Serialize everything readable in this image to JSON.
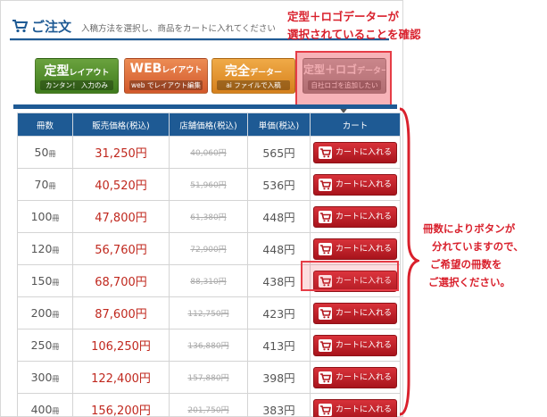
{
  "header": {
    "title": "ご注文",
    "description": "入稿方法を選択し、商品をカートに入れてください"
  },
  "layout_buttons": [
    {
      "main": "定型",
      "main_small": "レイアウト",
      "sub": "カンタン！ 入力のみ"
    },
    {
      "main": "WEB",
      "main_small": "レイアウト",
      "sub": "web でレイアウト編集"
    },
    {
      "main": "完全",
      "main_small": "データー",
      "sub": "ai ファイルで入稿"
    },
    {
      "main": "定型＋ロゴ",
      "main_small": "データー",
      "sub": "自社ロゴを追加したい"
    }
  ],
  "annotations": {
    "top_line1": "定型＋ロゴデーターが",
    "top_line2": "選択されていることを確認",
    "side_line1": "冊数によりボタンが",
    "side_line2": "分れていますので、",
    "side_line3": "ご希望の冊数を",
    "side_line4": "ご選択ください。"
  },
  "colors": {
    "primary_blue": "#1e5a94",
    "price_red": "#c0281e",
    "cart_red": "#b3181f",
    "annotation_red": "#d9202c"
  },
  "table": {
    "headers": [
      "冊数",
      "販売価格(税込)",
      "店舗価格(税込)",
      "単価(税込)",
      "カート"
    ],
    "qty_unit": "冊",
    "cart_label": "カートに入れる",
    "rows": [
      {
        "qty": "50",
        "sale": "31,250円",
        "store": "40,060円",
        "unit": "565円"
      },
      {
        "qty": "70",
        "sale": "40,520円",
        "store": "51,960円",
        "unit": "536円"
      },
      {
        "qty": "100",
        "sale": "47,800円",
        "store": "61,380円",
        "unit": "448円"
      },
      {
        "qty": "120",
        "sale": "56,760円",
        "store": "72,900円",
        "unit": "448円"
      },
      {
        "qty": "150",
        "sale": "68,700円",
        "store": "88,310円",
        "unit": "438円"
      },
      {
        "qty": "200",
        "sale": "87,600円",
        "store": "112,750円",
        "unit": "423円"
      },
      {
        "qty": "250",
        "sale": "106,250円",
        "store": "136,880円",
        "unit": "413円"
      },
      {
        "qty": "300",
        "sale": "122,400円",
        "store": "157,880円",
        "unit": "398円"
      },
      {
        "qty": "400",
        "sale": "156,200円",
        "store": "201,750円",
        "unit": "383円"
      }
    ]
  }
}
